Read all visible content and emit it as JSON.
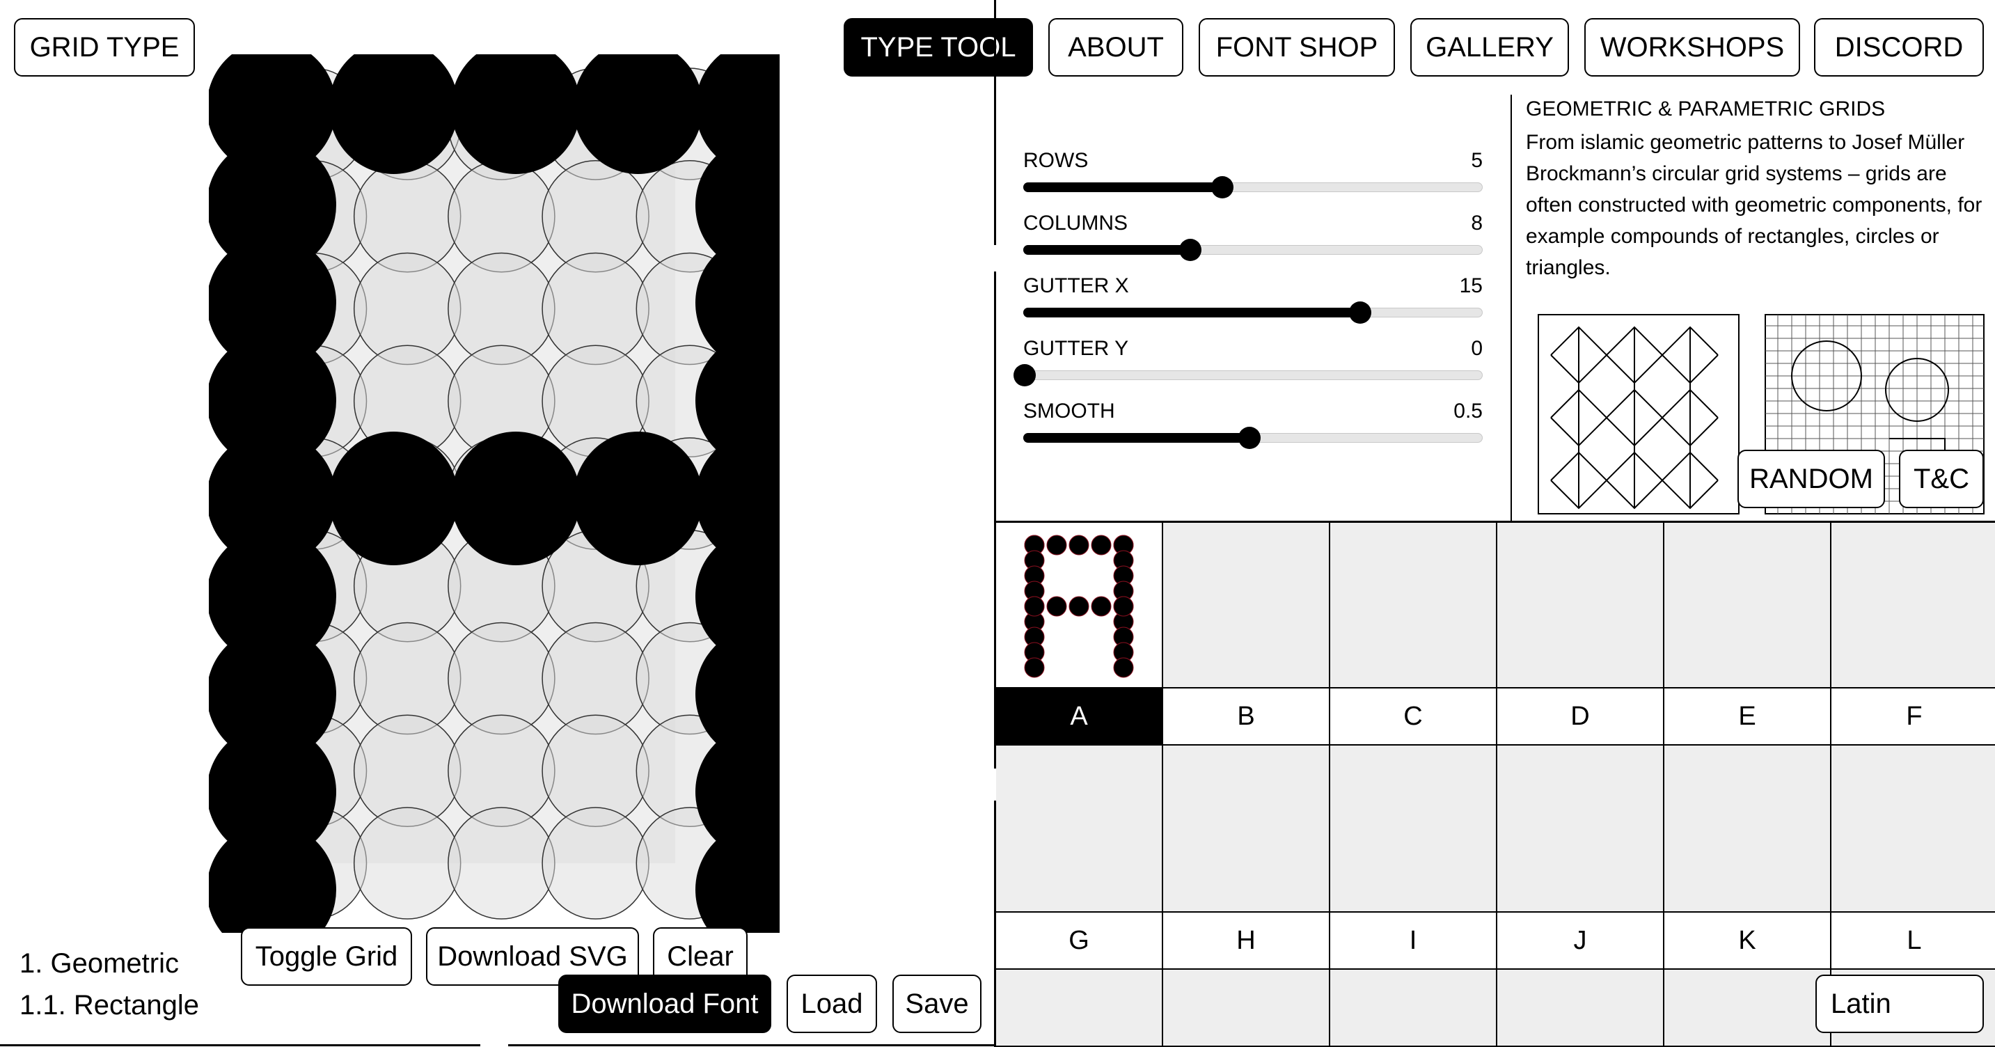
{
  "topbar": {
    "grid_type": "GRID TYPE",
    "nav": [
      "TYPE TOOL",
      "ABOUT",
      "FONT SHOP",
      "GALLERY",
      "WORKSHOPS",
      "DISCORD"
    ],
    "active_nav": "TYPE TOOL"
  },
  "controls": {
    "sliders": [
      {
        "label": "ROWS",
        "value": "5",
        "fraction": 0.43
      },
      {
        "label": "COLUMNS",
        "value": "8",
        "fraction": 0.36
      },
      {
        "label": "GUTTER X",
        "value": "15",
        "fraction": 0.73
      },
      {
        "label": "GUTTER Y",
        "value": "0",
        "fraction": 0.0
      },
      {
        "label": "SMOOTH",
        "value": "0.5",
        "fraction": 0.49
      }
    ]
  },
  "info": {
    "title": "GEOMETRIC & PARAMETRIC GRIDS",
    "text": "From islamic geometric patterns to Josef Müller Brockmann’s circular grid systems – grids are often constructed with geometric components, for example compounds of rectangles, circles or triangles."
  },
  "info_buttons": {
    "random": "RANDOM",
    "tc": "T&C"
  },
  "glyphs": {
    "row1": [
      "A",
      "B",
      "C",
      "D",
      "E",
      "F"
    ],
    "row2": [
      "G",
      "H",
      "I",
      "J",
      "K",
      "L"
    ],
    "active": "A"
  },
  "editor": {
    "toggle_grid": "Toggle Grid",
    "download_svg": "Download SVG",
    "clear": "Clear",
    "download_font": "Download Font",
    "load": "Load",
    "save": "Save"
  },
  "grid_list": [
    "1. Geometric",
    "1.1. Rectangle"
  ],
  "script_select": "Latin",
  "colors": {
    "accent": "#000000",
    "cell_bg": "#eeeeee",
    "grid_ellipse": "#dcdcdc"
  }
}
